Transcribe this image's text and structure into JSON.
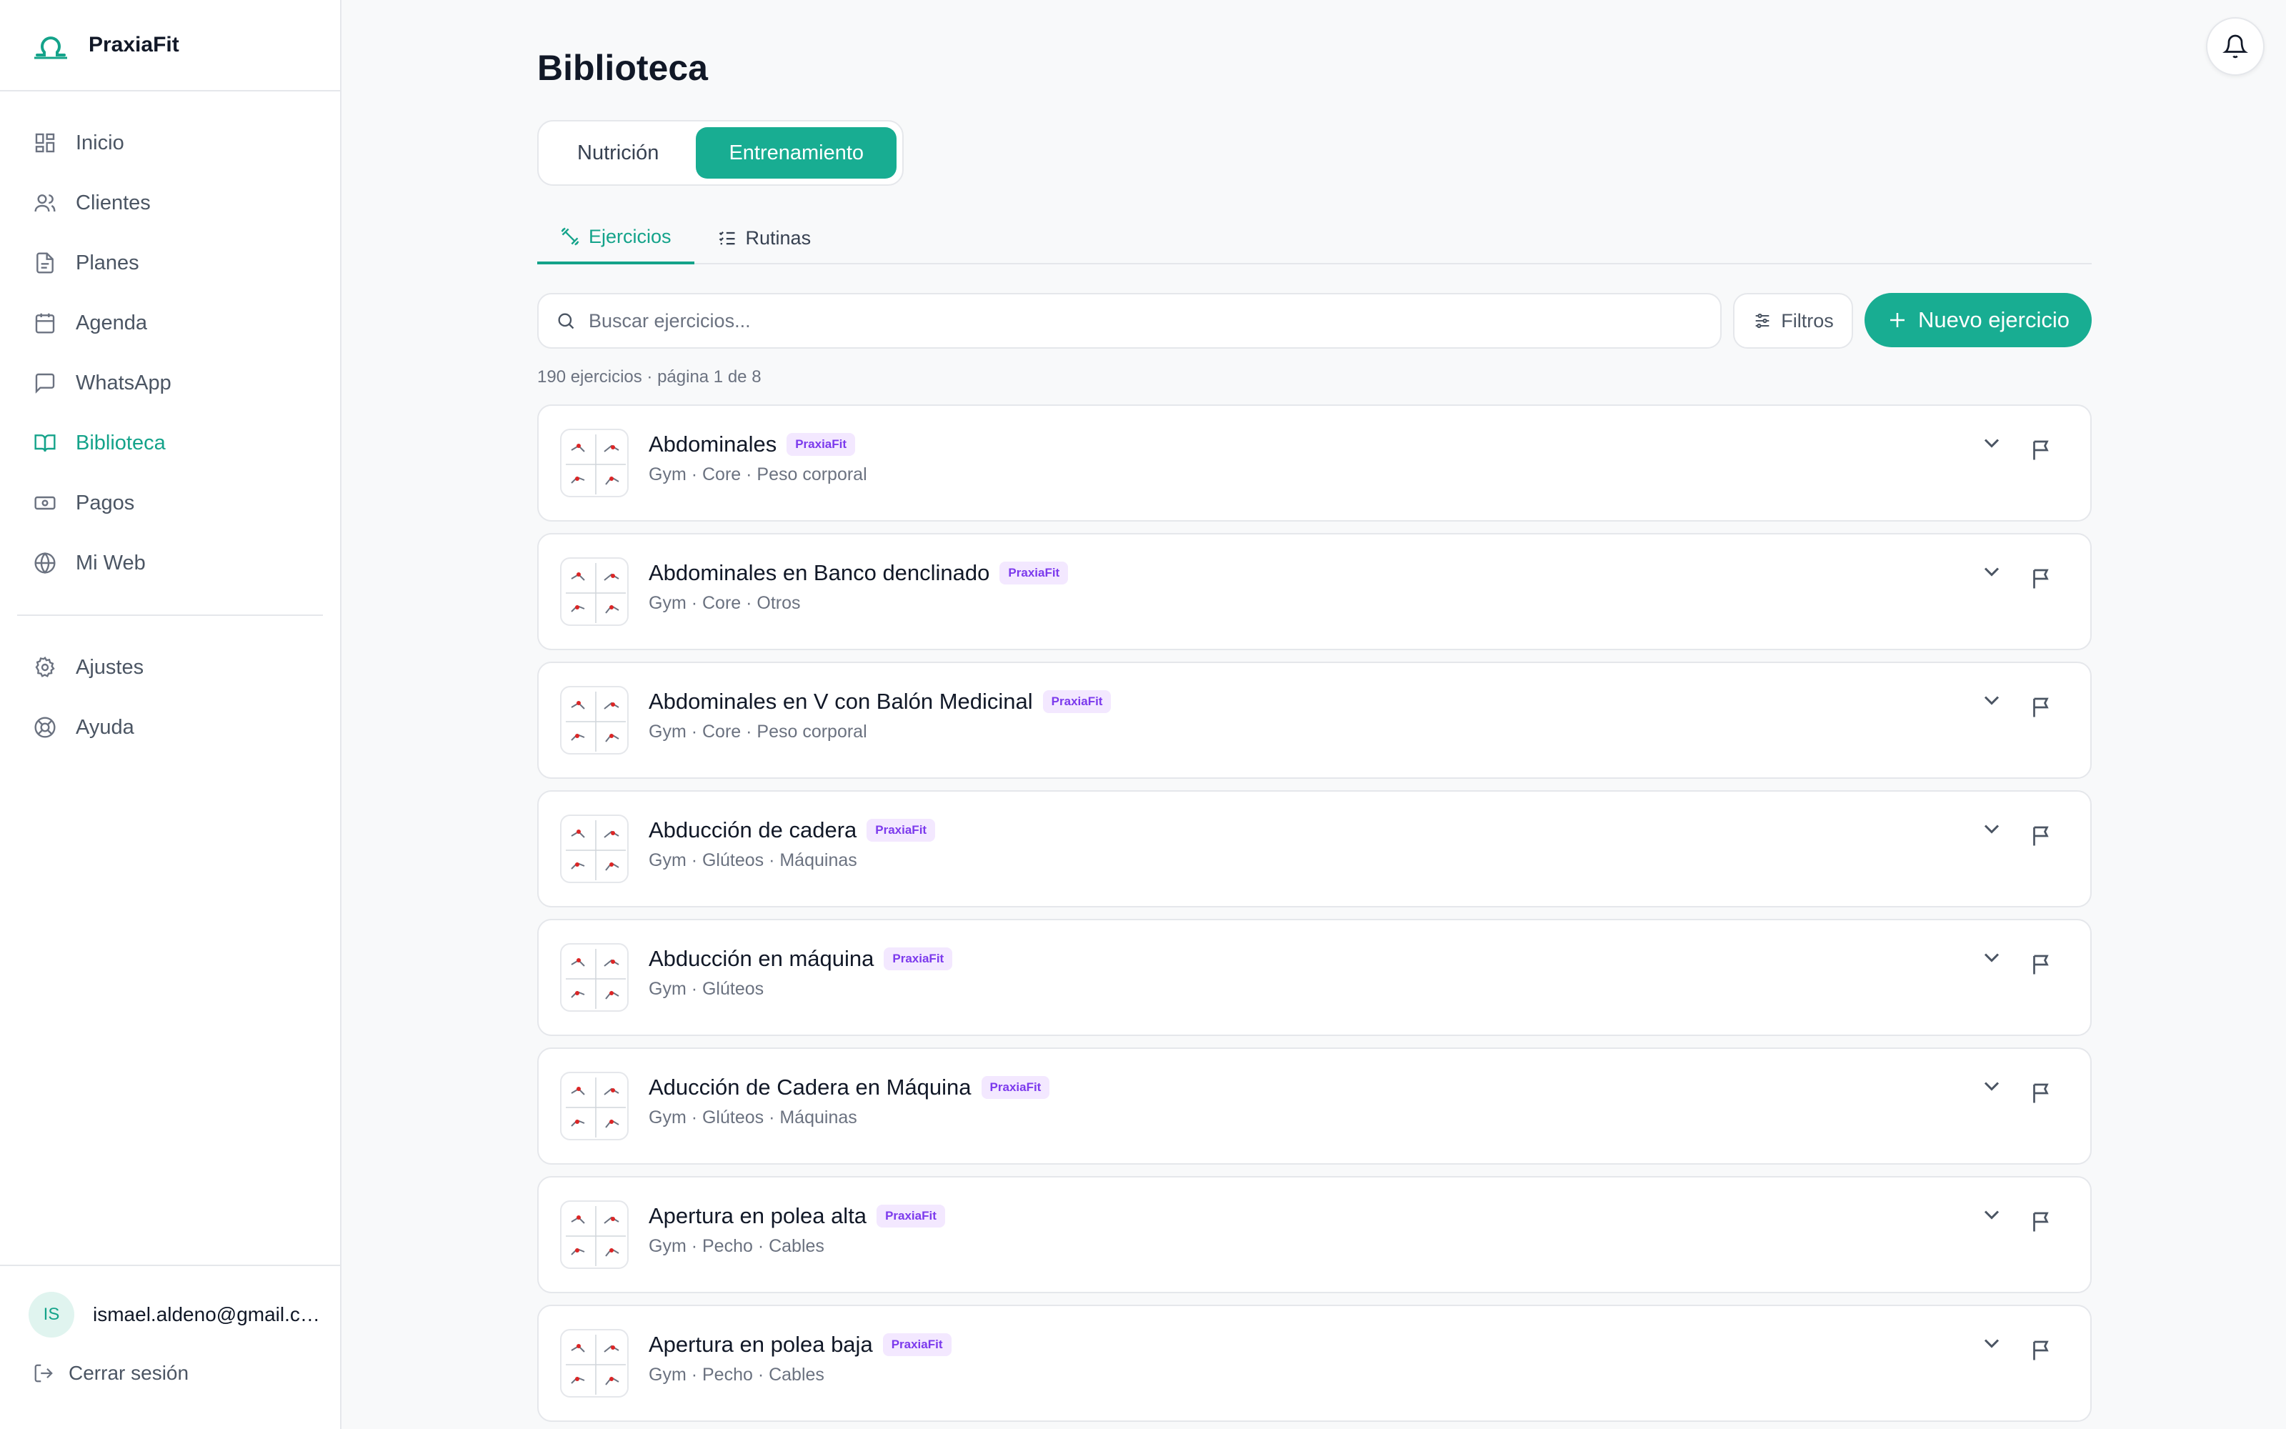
{
  "brand": {
    "name": "PraxiaFit",
    "accent": "#18ad92",
    "logo_icon": "omega-logo-icon"
  },
  "sidebar": {
    "items": [
      {
        "label": "Inicio",
        "icon": "dashboard-icon",
        "active": false
      },
      {
        "label": "Clientes",
        "icon": "users-icon",
        "active": false
      },
      {
        "label": "Planes",
        "icon": "document-icon",
        "active": false
      },
      {
        "label": "Agenda",
        "icon": "calendar-icon",
        "active": false
      },
      {
        "label": "WhatsApp",
        "icon": "chat-icon",
        "active": false
      },
      {
        "label": "Biblioteca",
        "icon": "book-icon",
        "active": true
      },
      {
        "label": "Pagos",
        "icon": "banknote-icon",
        "active": false
      },
      {
        "label": "Mi Web",
        "icon": "globe-icon",
        "active": false
      }
    ],
    "secondary": [
      {
        "label": "Ajustes",
        "icon": "gear-icon"
      },
      {
        "label": "Ayuda",
        "icon": "lifebuoy-icon"
      }
    ],
    "user": {
      "initials": "IS",
      "email": "ismael.aldeno@gmail.com"
    },
    "logout_label": "Cerrar sesión"
  },
  "header": {
    "bell_icon": "bell-icon"
  },
  "main": {
    "title": "Biblioteca",
    "segments": [
      {
        "label": "Nutrición",
        "selected": false
      },
      {
        "label": "Entrenamiento",
        "selected": true
      }
    ],
    "subtabs": [
      {
        "label": "Ejercicios",
        "icon": "dumbbell-icon",
        "selected": true
      },
      {
        "label": "Rutinas",
        "icon": "list-check-icon",
        "selected": false
      }
    ],
    "search": {
      "placeholder": "Buscar ejercicios...",
      "value": ""
    },
    "filters_label": "Filtros",
    "new_button_label": "Nuevo ejercicio",
    "count_text": "190 ejercicios · página 1 de 8",
    "exercises": [
      {
        "name": "Abdominales",
        "badge": "PraxiaFit",
        "tags": "Gym · Core · Peso corporal"
      },
      {
        "name": "Abdominales en Banco denclinado",
        "badge": "PraxiaFit",
        "tags": "Gym · Core · Otros"
      },
      {
        "name": "Abdominales en V con Balón Medicinal",
        "badge": "PraxiaFit",
        "tags": "Gym · Core · Peso corporal"
      },
      {
        "name": "Abducción de cadera",
        "badge": "PraxiaFit",
        "tags": "Gym · Glúteos · Máquinas"
      },
      {
        "name": "Abducción en máquina",
        "badge": "PraxiaFit",
        "tags": "Gym · Glúteos"
      },
      {
        "name": "Aducción de Cadera en Máquina",
        "badge": "PraxiaFit",
        "tags": "Gym · Glúteos · Máquinas"
      },
      {
        "name": "Apertura en polea alta",
        "badge": "PraxiaFit",
        "tags": "Gym · Pecho · Cables"
      },
      {
        "name": "Apertura en polea baja",
        "badge": "PraxiaFit",
        "tags": "Gym · Pecho · Cables"
      }
    ]
  }
}
